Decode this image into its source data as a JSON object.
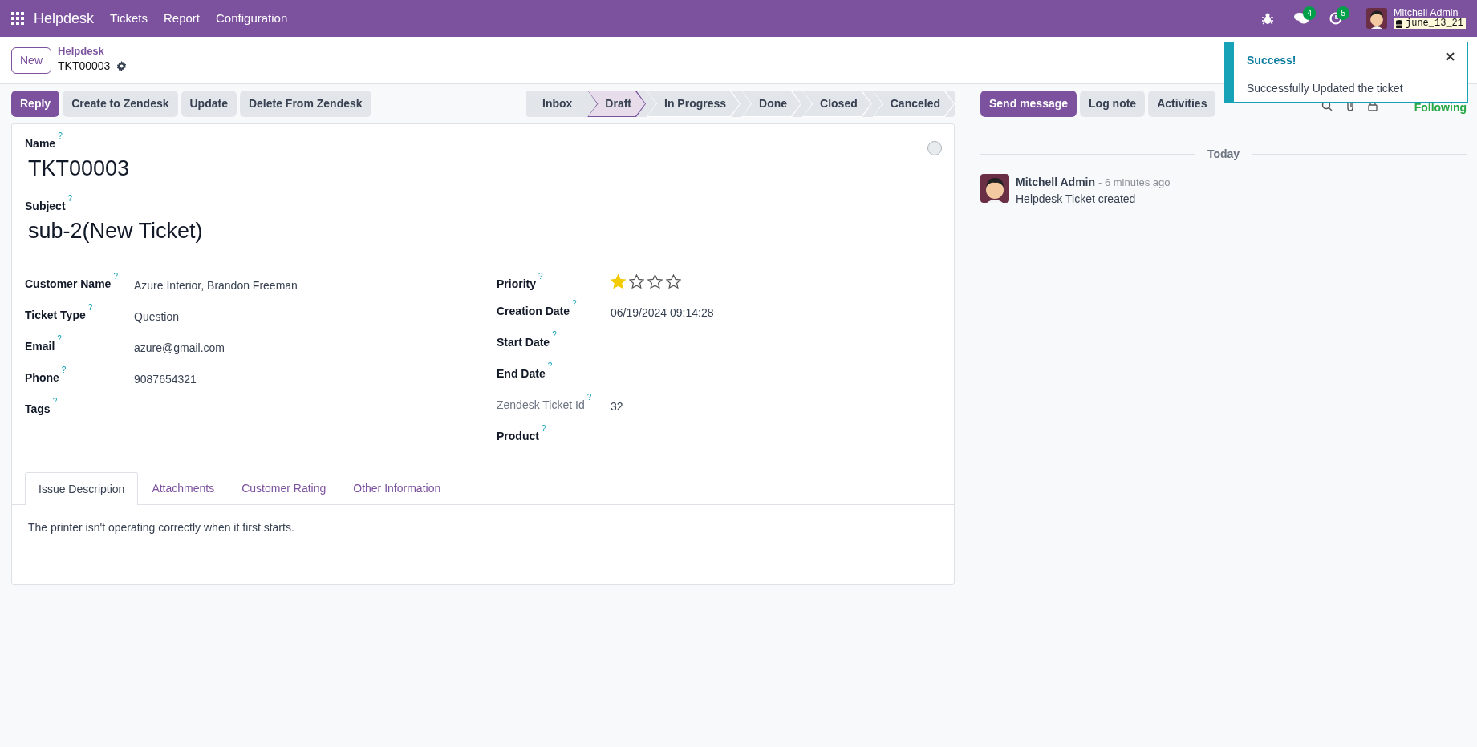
{
  "navbar": {
    "app": "Helpdesk",
    "menu": [
      "Tickets",
      "Report",
      "Configuration"
    ],
    "messages_count": "4",
    "activities_count": "5",
    "user": "Mitchell Admin",
    "database": "june_13_21"
  },
  "control_panel": {
    "new_button": "New",
    "breadcrumb": "Helpdesk",
    "record": "TKT00003"
  },
  "actions": [
    {
      "label": "Reply",
      "primary": true
    },
    {
      "label": "Create to Zendesk",
      "primary": false
    },
    {
      "label": "Update",
      "primary": false
    },
    {
      "label": "Delete From Zendesk",
      "primary": false
    }
  ],
  "stages": [
    {
      "label": "Inbox",
      "selected": false
    },
    {
      "label": "Draft",
      "selected": true
    },
    {
      "label": "In Progress",
      "selected": false
    },
    {
      "label": "Done",
      "selected": false
    },
    {
      "label": "Closed",
      "selected": false
    },
    {
      "label": "Canceled",
      "selected": false
    }
  ],
  "form": {
    "name_label": "Name",
    "help": "?",
    "name": "TKT00003",
    "subject_label": "Subject",
    "subject": "sub-2(New Ticket)",
    "left_fields": [
      {
        "label": "Customer Name",
        "value": "Azure Interior, Brandon Freeman",
        "readonly": false
      },
      {
        "label": "Ticket Type",
        "value": "Question",
        "readonly": false
      },
      {
        "label": "Email",
        "value": "azure@gmail.com",
        "readonly": false
      },
      {
        "label": "Phone",
        "value": "9087654321",
        "readonly": false
      },
      {
        "label": "Tags",
        "readonly": false
      }
    ],
    "priority": {
      "label": "Priority",
      "stars": 1
    },
    "right_fields": [
      {
        "label": "Creation Date",
        "value": "06/19/2024 09:14:28",
        "readonly": false
      },
      {
        "label": "Start Date",
        "readonly": false
      },
      {
        "label": "End Date",
        "readonly": false
      },
      {
        "label": "Zendesk Ticket Id",
        "value": "32",
        "readonly": true
      },
      {
        "label": "Product",
        "readonly": false
      }
    ],
    "tabs": [
      {
        "label": "Issue Description",
        "selected": true
      },
      {
        "label": "Attachments",
        "selected": false
      },
      {
        "label": "Customer Rating",
        "selected": false
      },
      {
        "label": "Other Information",
        "selected": false
      }
    ],
    "description": "The printer isn't operating correctly when it first starts."
  },
  "chatter": {
    "buttons": [
      {
        "label": "Send message",
        "primary": true
      },
      {
        "label": "Log note",
        "primary": false
      },
      {
        "label": "Activities",
        "primary": false
      }
    ],
    "following": "Following",
    "date_separator": "Today",
    "messages": [
      {
        "author": "Mitchell Admin",
        "time": "- 6 minutes ago",
        "body": "Helpdesk Ticket created"
      }
    ]
  },
  "toast": {
    "title": "Success!",
    "message": "Successfully Updated the ticket"
  }
}
